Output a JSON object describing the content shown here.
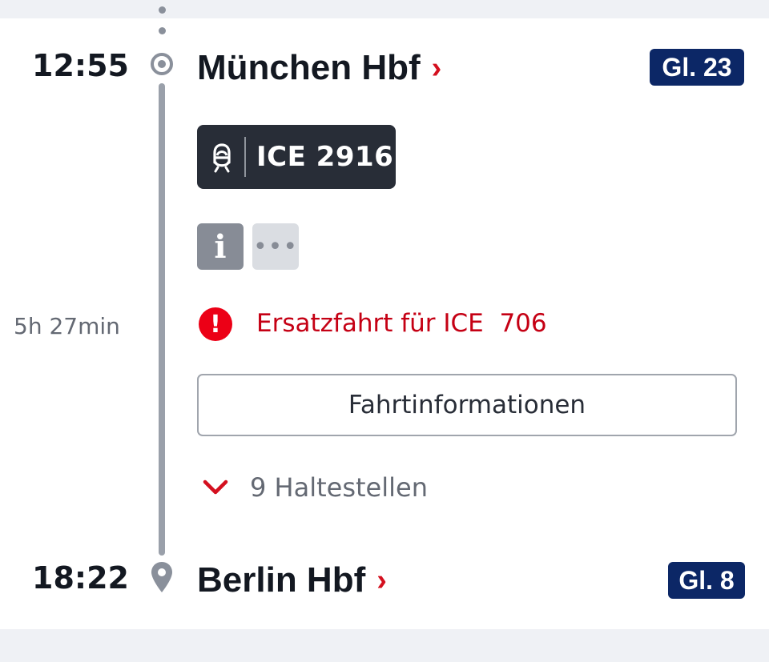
{
  "departure": {
    "time": "12:55",
    "station": "München Hbf",
    "platform": "Gl. 23"
  },
  "train": {
    "name": "ICE 2916",
    "icon": "train-icon"
  },
  "actions": {
    "info_label": "i",
    "more_label": "•••"
  },
  "duration": "5h 27min",
  "notice": {
    "icon": "warning-icon",
    "text": "Ersatzfahrt für ICE  706"
  },
  "details_button": "Fahrtinformationen",
  "stops": {
    "icon": "chevron-down-icon",
    "label": "9 Haltestellen"
  },
  "arrival": {
    "time": "18:22",
    "station": "Berlin Hbf",
    "platform": "Gl. 8"
  },
  "colors": {
    "accent_red": "#ec0016",
    "platform_blue": "#0c2766",
    "badge_dark": "#282d37"
  }
}
